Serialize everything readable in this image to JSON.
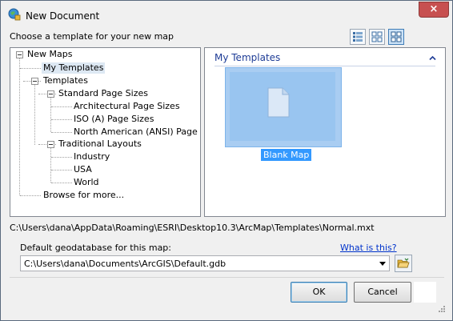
{
  "window": {
    "title": "New Document",
    "close_glyph": "×",
    "icon": "arcmap-globe-icon"
  },
  "header": {
    "choose_label": "Choose a template for your new map",
    "view_buttons": [
      {
        "name": "list-view-icon",
        "active": false
      },
      {
        "name": "small-thumbnail-view-icon",
        "active": false
      },
      {
        "name": "large-thumbnail-view-icon",
        "active": true
      }
    ]
  },
  "tree": {
    "items": [
      {
        "label": "New Maps",
        "level": 0,
        "expander": true
      },
      {
        "label": "My Templates",
        "level": 1,
        "selected": true
      },
      {
        "label": "Templates",
        "level": 1,
        "expander": true
      },
      {
        "label": "Standard Page Sizes",
        "level": 2,
        "expander": true
      },
      {
        "label": "Architectural Page Sizes",
        "level": 3
      },
      {
        "label": "ISO (A) Page Sizes",
        "level": 3
      },
      {
        "label": "North American (ANSI) Page Sizes",
        "level": 3
      },
      {
        "label": "Traditional Layouts",
        "level": 2,
        "expander": true
      },
      {
        "label": "Industry",
        "level": 3
      },
      {
        "label": "USA",
        "level": 3
      },
      {
        "label": "World",
        "level": 3
      },
      {
        "label": "Browse for more...",
        "level": 1
      }
    ]
  },
  "gallery": {
    "section_title": "My Templates",
    "items": [
      {
        "label": "Blank Map",
        "selected": true
      }
    ]
  },
  "template_path": "C:\\Users\\dana\\AppData\\Roaming\\ESRI\\Desktop10.3\\ArcMap\\Templates\\Normal.mxt",
  "geodatabase": {
    "label": "Default geodatabase for this map:",
    "link": "What is this?",
    "value": "C:\\Users\\dana\\Documents\\ArcGIS\\Default.gdb"
  },
  "buttons": {
    "ok": "OK",
    "cancel": "Cancel"
  },
  "colors": {
    "accent": "#3399ff",
    "section_header": "#1e3c96",
    "close_button": "#c75050",
    "link": "#0033cc"
  }
}
